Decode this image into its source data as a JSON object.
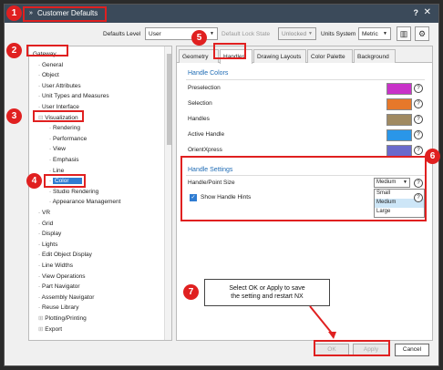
{
  "window": {
    "title": "Customer Defaults",
    "help": "?",
    "close": "✕"
  },
  "toolbar": {
    "defaults_level_label": "Defaults Level",
    "defaults_level_value": "User",
    "default_lock_label": "Default Lock State",
    "default_lock_value": "Unlocked",
    "units_label": "Units System",
    "units_value": "Metric"
  },
  "tree": {
    "items": [
      {
        "label": "Gateway",
        "prefix": ""
      },
      {
        "label": "General",
        "prefix": "- "
      },
      {
        "label": "Object",
        "prefix": "- "
      },
      {
        "label": "User Attributes",
        "prefix": "- "
      },
      {
        "label": "Unit Types and Measures",
        "prefix": "- "
      },
      {
        "label": "User Interface",
        "prefix": "- "
      },
      {
        "label": "Visualization",
        "prefix": "⊟ "
      },
      {
        "label": "Rendering",
        "prefix": "- "
      },
      {
        "label": "Performance",
        "prefix": "- "
      },
      {
        "label": "View",
        "prefix": "- "
      },
      {
        "label": "Emphasis",
        "prefix": "- "
      },
      {
        "label": "Line",
        "prefix": "- "
      },
      {
        "label": "Color",
        "prefix": "- "
      },
      {
        "label": "Studio Rendering",
        "prefix": "- "
      },
      {
        "label": "Appearance Management",
        "prefix": "- "
      },
      {
        "label": "VR",
        "prefix": "- "
      },
      {
        "label": "Grid",
        "prefix": "- "
      },
      {
        "label": "Display",
        "prefix": "- "
      },
      {
        "label": "Lights",
        "prefix": "- "
      },
      {
        "label": "Edit Object Display",
        "prefix": "- "
      },
      {
        "label": "Line Widths",
        "prefix": "- "
      },
      {
        "label": "View Operations",
        "prefix": "- "
      },
      {
        "label": "Part Navigator",
        "prefix": "- "
      },
      {
        "label": "Assembly Navigator",
        "prefix": "- "
      },
      {
        "label": "Reuse Library",
        "prefix": "- "
      },
      {
        "label": "Plotting/Printing",
        "prefix": "⊞ "
      },
      {
        "label": "Export",
        "prefix": "⊞ "
      }
    ]
  },
  "tabs": [
    "Geometry",
    "Handles",
    "Drawing Layouts",
    "Color Palette",
    "Background"
  ],
  "handle_colors": {
    "title": "Handle Colors",
    "rows": [
      {
        "label": "Preselection",
        "color": "#c832c8"
      },
      {
        "label": "Selection",
        "color": "#e6782a"
      },
      {
        "label": "Handles",
        "color": "#a08a62"
      },
      {
        "label": "Active Handle",
        "color": "#2a96e8"
      },
      {
        "label": "OrientXpress",
        "color": "#6a6acc"
      }
    ]
  },
  "handle_settings": {
    "title": "Handle Settings",
    "size_label": "Handle/Point Size",
    "size_value": "Medium",
    "size_options": [
      "Small",
      "Medium",
      "Large"
    ],
    "hints_label": "Show Handle Hints"
  },
  "buttons": {
    "ok": "OK",
    "apply": "Apply",
    "cancel": "Cancel"
  },
  "annotations": {
    "badges": [
      "1",
      "2",
      "3",
      "4",
      "5",
      "6",
      "7"
    ],
    "callout_line1": "Select OK or Apply to save",
    "callout_line2": "the setting and restart NX"
  },
  "colors": {
    "annotation": "#e02020",
    "accent": "#2f7cd2",
    "titlebar": "#3b4a5a"
  }
}
